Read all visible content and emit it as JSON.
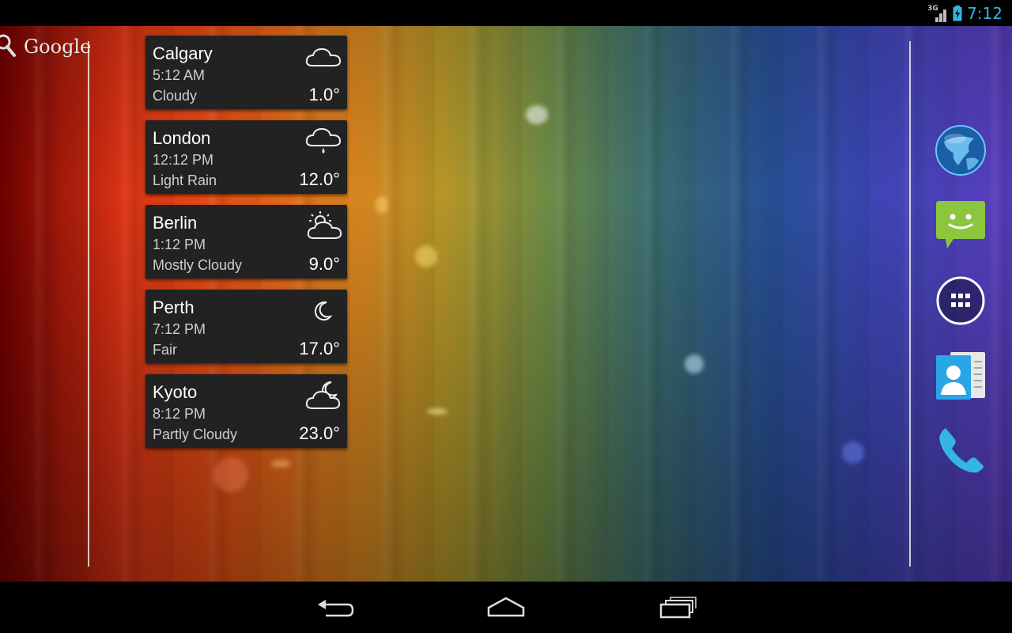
{
  "status_bar": {
    "network": "3G",
    "time": "7:12"
  },
  "search": {
    "label": "Google"
  },
  "weather": [
    {
      "city": "Calgary",
      "time": "5:12 AM",
      "condition": "Cloudy",
      "temp": "1.0°",
      "icon": "cloud-icon"
    },
    {
      "city": "London",
      "time": "12:12 PM",
      "condition": "Light Rain",
      "temp": "12.0°",
      "icon": "rain-cloud-icon"
    },
    {
      "city": "Berlin",
      "time": "1:12 PM",
      "condition": "Mostly Cloudy",
      "temp": "9.0°",
      "icon": "sun-cloud-icon"
    },
    {
      "city": "Perth",
      "time": "7:12 PM",
      "condition": "Fair",
      "temp": "17.0°",
      "icon": "moon-icon"
    },
    {
      "city": "Kyoto",
      "time": "8:12 PM",
      "condition": "Partly Cloudy",
      "temp": "23.0°",
      "icon": "moon-cloud-icon"
    }
  ],
  "dock": [
    "browser-globe-icon",
    "messaging-icon",
    "all-apps-icon",
    "contacts-icon",
    "phone-icon"
  ],
  "nav": [
    "back-icon",
    "home-icon",
    "recent-apps-icon"
  ],
  "colors": {
    "accent": "#33b5e5",
    "card_bg": "#222222",
    "message_green": "#8cc63e"
  }
}
